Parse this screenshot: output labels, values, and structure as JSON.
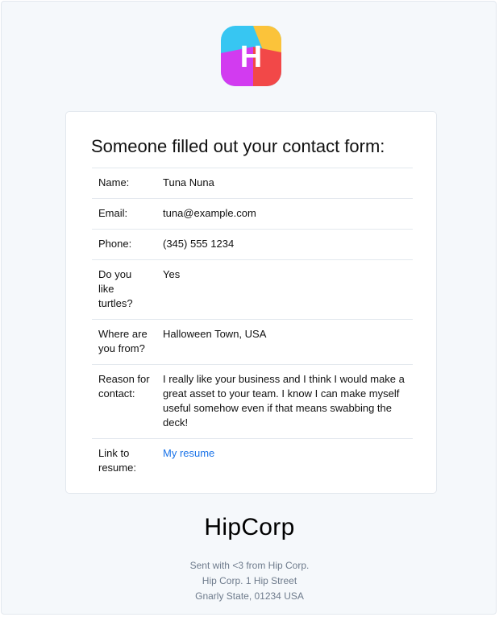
{
  "logo": {
    "letter": "H",
    "colors": {
      "cyan": "#37c6f2",
      "yellow": "#fbc33a",
      "magenta": "#d23bf0",
      "red": "#f24848"
    }
  },
  "card": {
    "title": "Someone filled out your contact form:",
    "fields": [
      {
        "label": "Name:",
        "value": "Tuna Nuna"
      },
      {
        "label": "Email:",
        "value": "tuna@example.com"
      },
      {
        "label": "Phone:",
        "value": "(345) 555 1234"
      },
      {
        "label": "Do you like turtles?",
        "value": "Yes"
      },
      {
        "label": "Where are you from?",
        "value": "Halloween Town, USA"
      },
      {
        "label": "Reason for contact:",
        "value": "I really like your business and I think I would make a great asset to your team. I know I can make myself useful somehow even if that means swabbing the deck!"
      },
      {
        "label": "Link to resume:",
        "value": "My resume"
      }
    ]
  },
  "footer": {
    "brand": "HipCorp",
    "lines": [
      "Sent with <3 from Hip Corp.",
      "Hip Corp. 1 Hip Street",
      "Gnarly State, 01234 USA"
    ]
  },
  "colors": {
    "link": "#1a73e8",
    "footer_text": "#6e7b8c",
    "background": "#f5f8fb"
  }
}
